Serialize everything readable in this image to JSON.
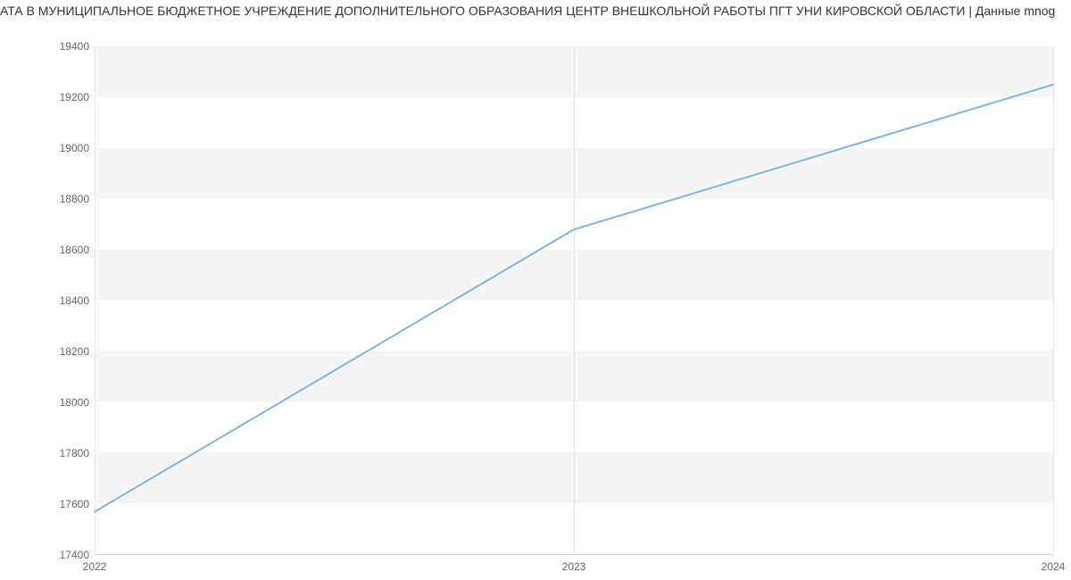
{
  "title": "АТА В МУНИЦИПАЛЬНОЕ БЮДЖЕТНОЕ УЧРЕЖДЕНИЕ ДОПОЛНИТЕЛЬНОГО ОБРАЗОВАНИЯ ЦЕНТР ВНЕШКОЛЬНОЙ РАБОТЫ ПГТ УНИ КИРОВСКОЙ ОБЛАСТИ | Данные mnog",
  "y_ticks": [
    "17400",
    "17600",
    "17800",
    "18000",
    "18200",
    "18400",
    "18600",
    "18800",
    "19000",
    "19200",
    "19400"
  ],
  "x_ticks": [
    "2022",
    "2023",
    "2024"
  ],
  "chart_data": {
    "type": "line",
    "title": "АТА В МУНИЦИПАЛЬНОЕ БЮДЖЕТНОЕ УЧРЕЖДЕНИЕ ДОПОЛНИТЕЛЬНОГО ОБРАЗОВАНИЯ ЦЕНТР ВНЕШКОЛЬНОЙ РАБОТЫ ПГТ УНИ КИРОВСКОЙ ОБЛАСТИ | Данные mnog",
    "xlabel": "",
    "ylabel": "",
    "x": [
      2022,
      2023,
      2024
    ],
    "values": [
      17570,
      18680,
      19250
    ],
    "xlim": [
      2022,
      2024
    ],
    "ylim": [
      17400,
      19400
    ],
    "line_color": "#7cb5ec",
    "grid": true
  }
}
